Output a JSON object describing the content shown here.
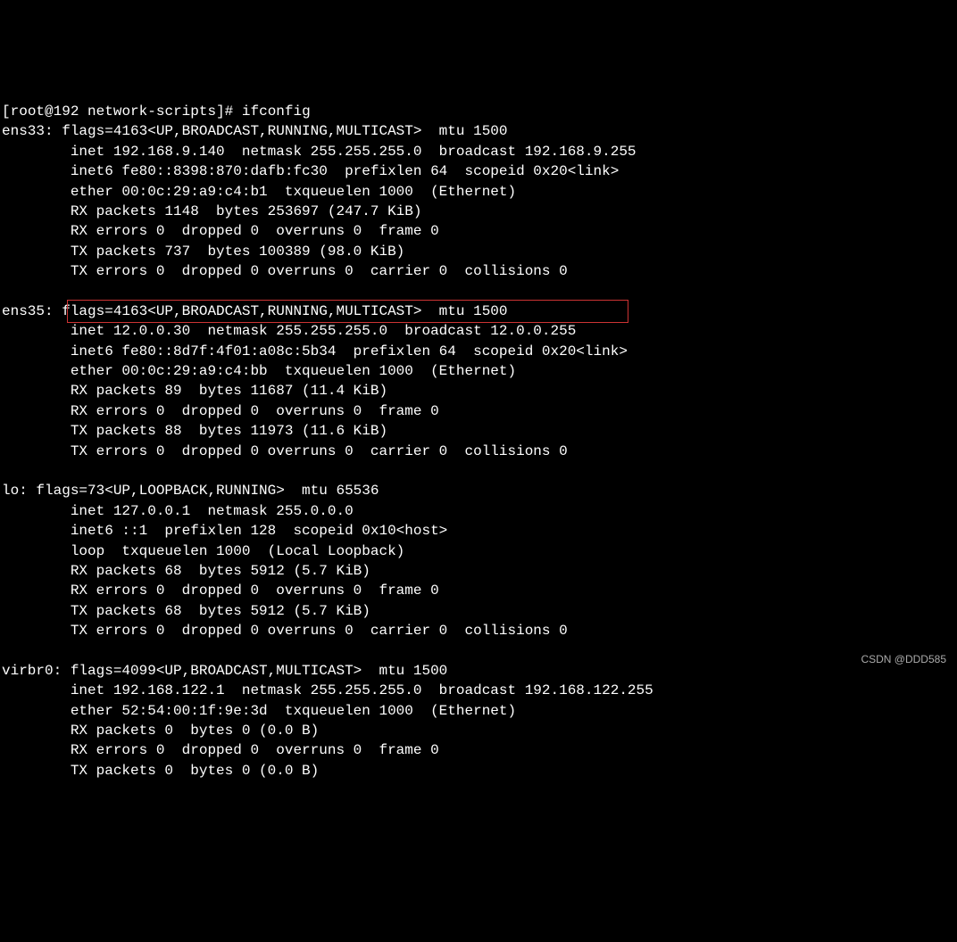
{
  "prompt": {
    "user": "root",
    "host": "192",
    "cwd": "network-scripts",
    "command": "ifconfig"
  },
  "interfaces": {
    "ens33": {
      "header": "ens33: flags=4163<UP,BROADCAST,RUNNING,MULTICAST>  mtu 1500",
      "inet": "        inet 192.168.9.140  netmask 255.255.255.0  broadcast 192.168.9.255",
      "inet6": "        inet6 fe80::8398:870:dafb:fc30  prefixlen 64  scopeid 0x20<link>",
      "ether": "        ether 00:0c:29:a9:c4:b1  txqueuelen 1000  (Ethernet)",
      "rx_packets": "        RX packets 1148  bytes 253697 (247.7 KiB)",
      "rx_errors": "        RX errors 0  dropped 0  overruns 0  frame 0",
      "tx_packets": "        TX packets 737  bytes 100389 (98.0 KiB)",
      "tx_errors": "        TX errors 0  dropped 0 overruns 0  carrier 0  collisions 0"
    },
    "ens35": {
      "header": "ens35: flags=4163<UP,BROADCAST,RUNNING,MULTICAST>  mtu 1500",
      "inet": "        inet 12.0.0.30  netmask 255.255.255.0  broadcast 12.0.0.255",
      "inet6": "        inet6 fe80::8d7f:4f01:a08c:5b34  prefixlen 64  scopeid 0x20<link>",
      "ether": "        ether 00:0c:29:a9:c4:bb  txqueuelen 1000  (Ethernet)",
      "rx_packets": "        RX packets 89  bytes 11687 (11.4 KiB)",
      "rx_errors": "        RX errors 0  dropped 0  overruns 0  frame 0",
      "tx_packets": "        TX packets 88  bytes 11973 (11.6 KiB)",
      "tx_errors": "        TX errors 0  dropped 0 overruns 0  carrier 0  collisions 0"
    },
    "lo": {
      "header": "lo: flags=73<UP,LOOPBACK,RUNNING>  mtu 65536",
      "inet": "        inet 127.0.0.1  netmask 255.0.0.0",
      "inet6": "        inet6 ::1  prefixlen 128  scopeid 0x10<host>",
      "loop": "        loop  txqueuelen 1000  (Local Loopback)",
      "rx_packets": "        RX packets 68  bytes 5912 (5.7 KiB)",
      "rx_errors": "        RX errors 0  dropped 0  overruns 0  frame 0",
      "tx_packets": "        TX packets 68  bytes 5912 (5.7 KiB)",
      "tx_errors": "        TX errors 0  dropped 0 overruns 0  carrier 0  collisions 0"
    },
    "virbr0": {
      "header": "virbr0: flags=4099<UP,BROADCAST,MULTICAST>  mtu 1500",
      "inet": "        inet 192.168.122.1  netmask 255.255.255.0  broadcast 192.168.122.255",
      "ether": "        ether 52:54:00:1f:9e:3d  txqueuelen 1000  (Ethernet)",
      "rx_packets": "        RX packets 0  bytes 0 (0.0 B)",
      "rx_errors": "        RX errors 0  dropped 0  overruns 0  frame 0",
      "tx_packets": "        TX packets 0  bytes 0 (0.0 B)"
    }
  },
  "watermark": "CSDN @DDD585"
}
